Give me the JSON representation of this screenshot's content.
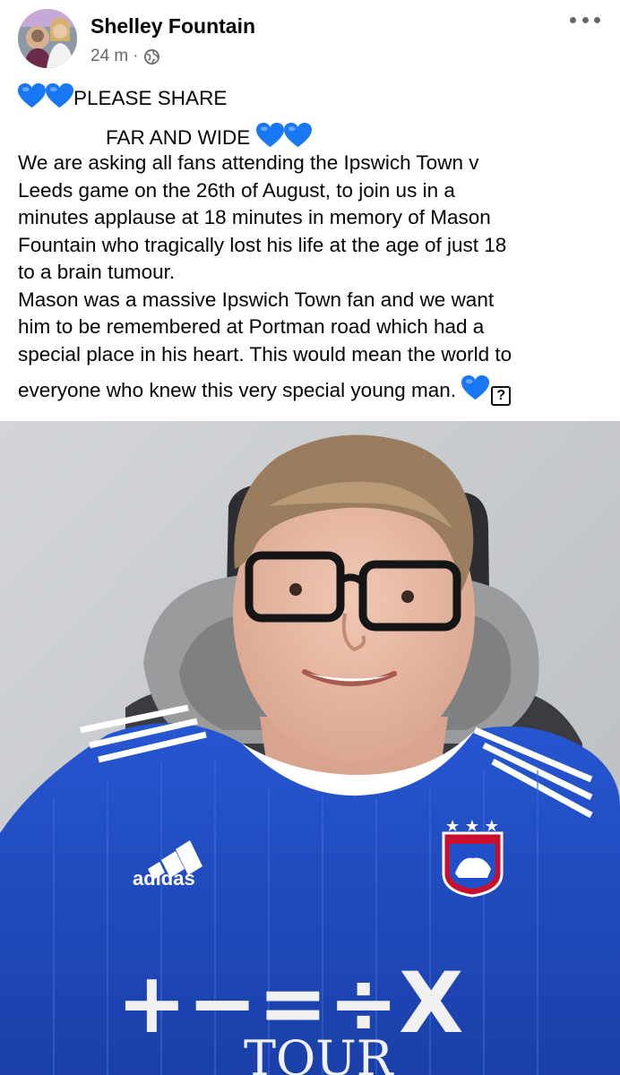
{
  "post": {
    "author": "Shelley Fountain",
    "timestamp": "24 m",
    "separator": "·",
    "privacy_icon": "globe-icon",
    "more_icon": "more-horizontal-icon",
    "lines": [
      "PLEASE SHARE",
      "FAR AND WIDE",
      "We are asking all fans attending the Ipswich Town v",
      "Leeds game on the 26th of August, to join us in a",
      "minutes applause at 18 minutes in memory of Mason",
      "Fountain who tragically lost his life at the age of just 18",
      "to a brain tumour.",
      "Mason was a massive  Ipswich Town fan and we want",
      "him to be remembered at Portman road which had a",
      "special place in his heart. This would mean the world to",
      "everyone who knew this very special young man."
    ],
    "unknown_glyph": "?",
    "heart_color": "#1877f2"
  },
  "photo": {
    "shirt_brand": "adidas",
    "sponsor_symbols": "+−=÷X",
    "sponsor_word": "TOUR",
    "shirt_color": "#1f50c9",
    "hood_color": "#9a9b9d"
  }
}
